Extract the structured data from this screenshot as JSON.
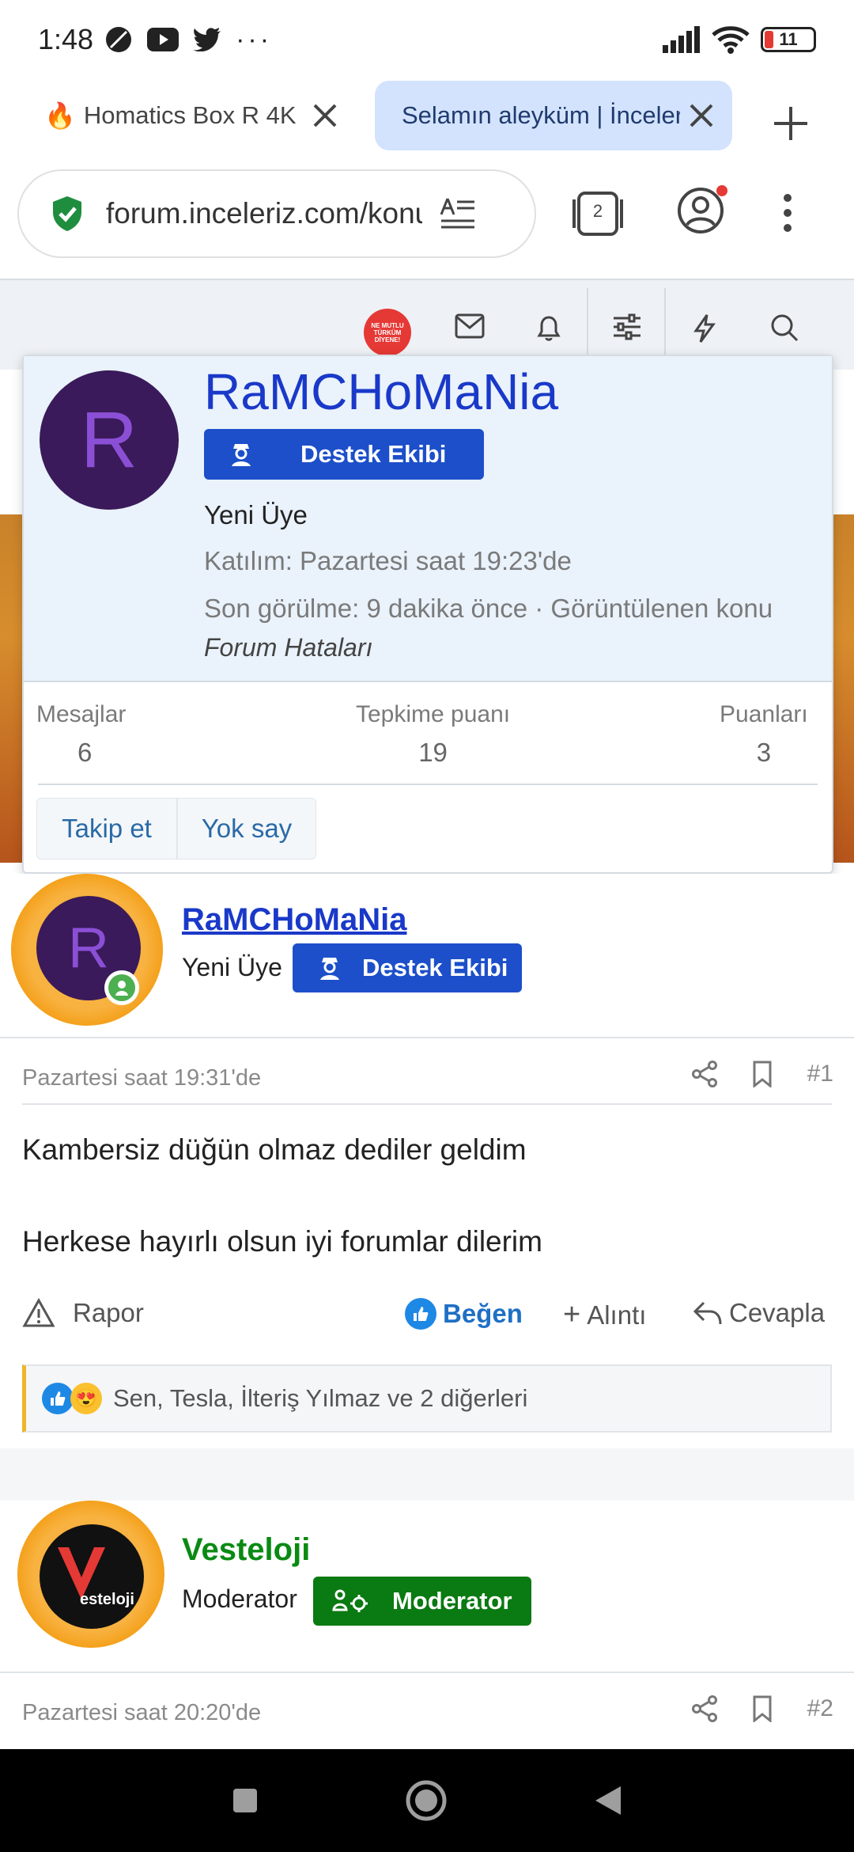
{
  "status_bar": {
    "time": "1:48",
    "battery": "11"
  },
  "tabs": [
    {
      "title": "Homatics Box R 4K",
      "favicon": "fire-icon"
    },
    {
      "title": "Selamın aleyküm | İnceleriz",
      "favicon": ""
    }
  ],
  "address": {
    "url": "forum.inceleriz.com/konu",
    "tab_count": "2"
  },
  "site_header": {
    "badge_text": "NE MUTLU TÜRKÜM DİYENE!"
  },
  "popup": {
    "name": "RaMCHoMaNia",
    "avatar_letter": "R",
    "badge": "Destek Ekibi",
    "role": "Yeni Üye",
    "joined": "Katılım: Pazartesi saat 19:23'de",
    "last_seen": "Son görülme: 9 dakika önce · Görüntülenen konu",
    "viewed_topic": "Forum Hataları",
    "stats": [
      {
        "label": "Mesajlar",
        "value": "6"
      },
      {
        "label": "Tepkime puanı",
        "value": "19"
      },
      {
        "label": "Puanları",
        "value": "3"
      }
    ],
    "follow_button": "Takip et",
    "ignore_button": "Yok say"
  },
  "post1": {
    "author": "RaMCHoMaNia",
    "avatar_letter": "R",
    "role": "Yeni Üye",
    "badge": "Destek Ekibi",
    "date": "Pazartesi saat 19:31'de",
    "number": "#1",
    "line1": "Kambersiz düğün olmaz dediler geldim",
    "line2": "Herkese hayırlı olsun iyi forumlar dilerim",
    "report": "Rapor",
    "like": "Beğen",
    "quote": "Alıntı",
    "reply": "Cevapla",
    "reactions": "Sen, Tesla, İlteriş Yılmaz ve 2 diğerleri"
  },
  "post2": {
    "author": "Vesteloji",
    "role": "Moderator",
    "badge": "Moderator",
    "avatar_text": "esteloji",
    "date": "Pazartesi saat 20:20'de",
    "number": "#2"
  },
  "colors": {
    "link_blue": "#1a39c9",
    "badge_blue": "#1c4fc9",
    "moderator_green": "#0a7a12",
    "accent_orange": "#f39c12"
  }
}
